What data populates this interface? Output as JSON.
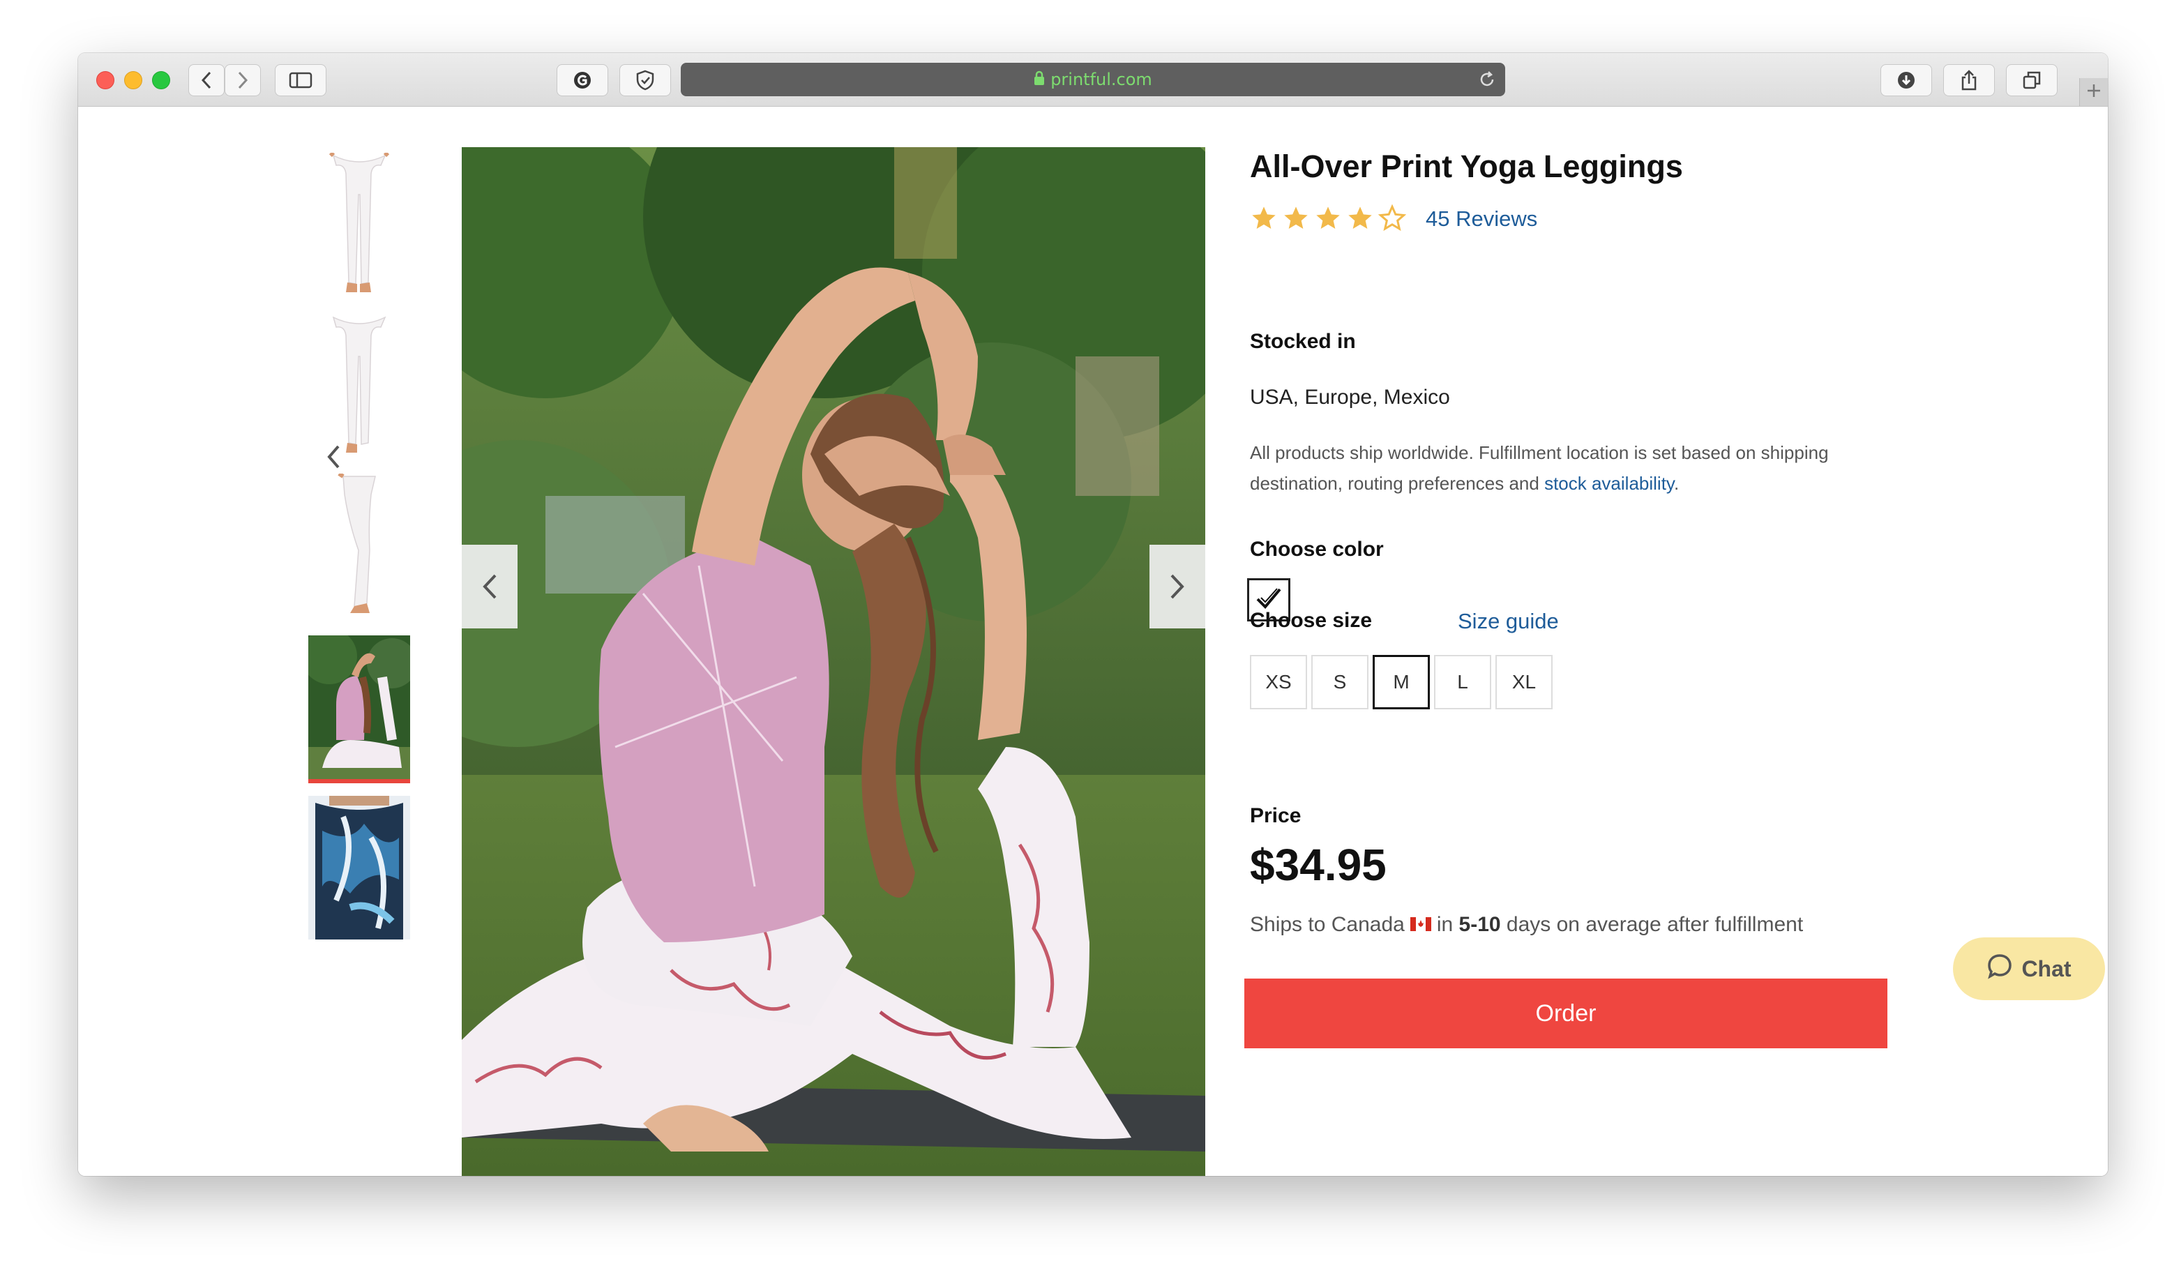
{
  "browser": {
    "url": "printful.com",
    "icons": [
      "back-arrow-icon",
      "forward-arrow-icon",
      "sidebar-icon",
      "grammarly-icon",
      "shield-icon",
      "lock-icon",
      "reload-icon",
      "download-icon",
      "share-icon",
      "tabs-icon",
      "plus-icon"
    ]
  },
  "gallery": {
    "thumbnails": [
      {
        "id": "front-view"
      },
      {
        "id": "back-view"
      },
      {
        "id": "side-view"
      },
      {
        "id": "yoga-pose",
        "active": true
      },
      {
        "id": "blue-print"
      }
    ]
  },
  "product": {
    "title": "All-Over Print Yoga Leggings",
    "rating": 4,
    "rating_max": 5,
    "reviews_label": "45 Reviews",
    "stocked_label": "Stocked in",
    "stocked_value": "USA, Europe, Mexico",
    "ship_note_1": "All products ship worldwide. Fulfillment location is set based on shipping",
    "ship_note_2": "destination, routing preferences and ",
    "ship_note_link": "stock availability",
    "ship_note_end": ".",
    "color_label": "Choose color",
    "size_label": "Choose size",
    "size_guide": "Size guide",
    "sizes": [
      "XS",
      "S",
      "M",
      "L",
      "XL"
    ],
    "selected_size": "M",
    "price_label": "Price",
    "price": "$34.95",
    "ships_pre": "Ships to Canada",
    "ships_in": "in",
    "ships_days": "5-10",
    "ships_post": "days on average after fulfillment",
    "order_label": "Order"
  },
  "chat": {
    "label": "Chat"
  },
  "colors": {
    "accent_red": "#ef4640",
    "link_blue": "#1e5c99",
    "star": "#f2b94a",
    "chat_bg": "#f9e7a3"
  }
}
